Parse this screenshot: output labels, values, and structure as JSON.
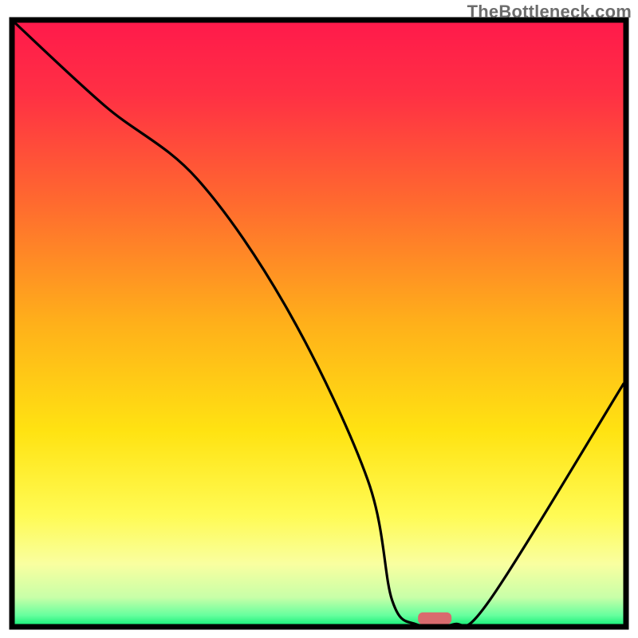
{
  "watermark": "TheBottleneck.com",
  "chart_data": {
    "type": "line",
    "title": "",
    "xlabel": "",
    "ylabel": "",
    "xlim": [
      0,
      100
    ],
    "ylim": [
      0,
      100
    ],
    "x": [
      0,
      15,
      30,
      45,
      58,
      62,
      66,
      72,
      78,
      100
    ],
    "values": [
      100,
      86,
      74,
      52,
      24,
      4,
      0,
      0,
      4,
      40
    ],
    "grid": false,
    "legend": false,
    "background_gradient": {
      "direction": "vertical",
      "stops": [
        {
          "pos": 0.0,
          "color": "#ff1a4b"
        },
        {
          "pos": 0.12,
          "color": "#ff3044"
        },
        {
          "pos": 0.3,
          "color": "#ff6a2f"
        },
        {
          "pos": 0.5,
          "color": "#ffb01a"
        },
        {
          "pos": 0.68,
          "color": "#ffe312"
        },
        {
          "pos": 0.82,
          "color": "#fffb55"
        },
        {
          "pos": 0.9,
          "color": "#f9ffa0"
        },
        {
          "pos": 0.955,
          "color": "#c8ffa8"
        },
        {
          "pos": 0.985,
          "color": "#66ff9e"
        },
        {
          "pos": 1.0,
          "color": "#1cf07a"
        }
      ]
    },
    "marker": {
      "x": 69,
      "y": 0,
      "w": 5.5,
      "h": 2,
      "color": "#d96b6e"
    }
  }
}
